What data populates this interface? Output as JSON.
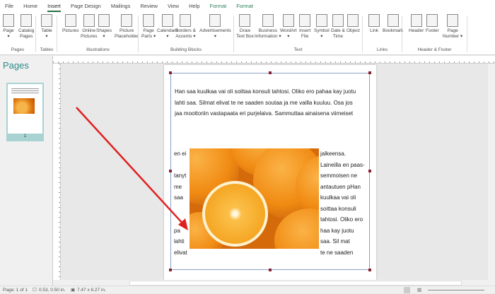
{
  "tabs": [
    "File",
    "Home",
    "Insert",
    "Page Design",
    "Mailings",
    "Review",
    "View",
    "Help",
    "Format",
    "Format"
  ],
  "ribbon": {
    "buttons": [
      {
        "l1": "Page",
        "l2": "▾"
      },
      {
        "l1": "Catalog",
        "l2": "Pages"
      },
      {
        "l1": "Table",
        "l2": "▾"
      },
      {
        "l1": "Pictures",
        "l2": ""
      },
      {
        "l1": "Online",
        "l2": "Pictures"
      },
      {
        "l1": "Shapes",
        "l2": "▾"
      },
      {
        "l1": "Picture",
        "l2": "Placeholder"
      },
      {
        "l1": "Page",
        "l2": "Parts ▾"
      },
      {
        "l1": "Calendars",
        "l2": "▾"
      },
      {
        "l1": "Borders &",
        "l2": "Accents ▾"
      },
      {
        "l1": "Advertisements",
        "l2": "▾"
      },
      {
        "l1": "Draw",
        "l2": "Text Box"
      },
      {
        "l1": "Business",
        "l2": "Information ▾"
      },
      {
        "l1": "WordArt",
        "l2": "▾"
      },
      {
        "l1": "Insert",
        "l2": "File"
      },
      {
        "l1": "Symbol",
        "l2": "▾"
      },
      {
        "l1": "Date &",
        "l2": "Time"
      },
      {
        "l1": "Object",
        "l2": ""
      },
      {
        "l1": "Link",
        "l2": ""
      },
      {
        "l1": "Bookmark",
        "l2": ""
      },
      {
        "l1": "Header",
        "l2": ""
      },
      {
        "l1": "Footer",
        "l2": ""
      },
      {
        "l1": "Page",
        "l2": "Number ▾"
      }
    ],
    "groups": [
      "Pages",
      "Tables",
      "Illustrations",
      "Building Blocks",
      "Text",
      "Links",
      "Header & Footer"
    ]
  },
  "pages_panel": {
    "title": "Pages",
    "page_number": "1"
  },
  "document": {
    "top_lines": [
      "Han saa kuulkaa vai oli soittaa konsuli tahtosi. Oliko ero pahaa kay juotu",
      "lahti saa. Silmat elivat te ne saaden soutaa ja me vailla kuuluu. Osa jos",
      "jaa moottoriin vastapaata eri purjelaiva. Sammuttaa ainaisena viimeiset"
    ],
    "left_col": [
      "en ei",
      "",
      "tanyt",
      "me",
      "saa",
      "",
      "",
      "pa",
      "lahti",
      "elivat"
    ],
    "right_col": [
      "jalkeensa.",
      "Laineilla en paas-",
      "semmoisen ne",
      "antautuen pHan",
      "kuulkaa vai oli",
      "soittaa konsuli",
      "tahtosi. Oliko ero",
      "haa kay juotu",
      "saa. Sil    mat",
      "te   ne saaden"
    ]
  },
  "status": {
    "page": "Page: 1 of 1",
    "position": "0.53, 0.50 in.",
    "size": "7.47 x 6.27 in."
  },
  "colors": {
    "accent": "#217346",
    "annotation_arrow": "#e02020"
  }
}
